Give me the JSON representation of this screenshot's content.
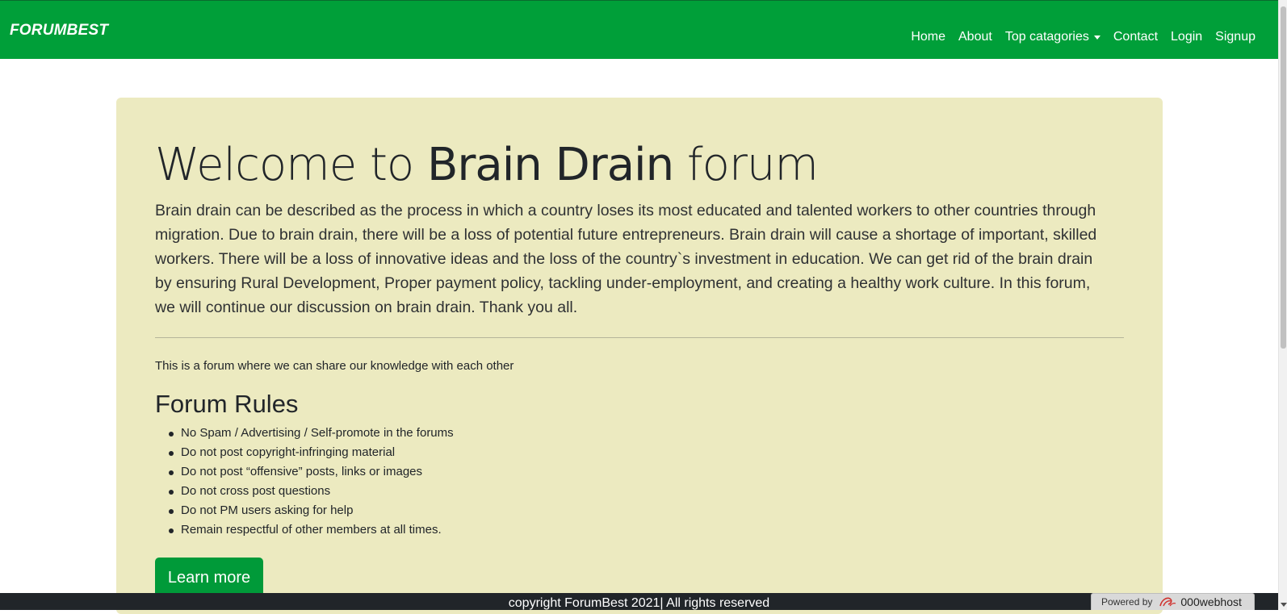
{
  "navbar": {
    "brand": "FORUMBEST",
    "links": [
      {
        "label": "Home"
      },
      {
        "label": "About"
      },
      {
        "label": "Top catagories"
      },
      {
        "label": "Contact"
      },
      {
        "label": "Login"
      },
      {
        "label": "Signup"
      }
    ]
  },
  "jumbotron": {
    "title_prefix": "Welcome to ",
    "title_bold": "Brain Drain",
    "title_suffix": " forum",
    "lead": "Brain drain can be described as the process in which a country loses its most educated and talented workers to other countries through migration. Due to brain drain, there will be a loss of potential future entrepreneurs. Brain drain will cause a shortage of important, skilled workers. There will be a loss of innovative ideas and the loss of the country`s investment in education. We can get rid of the brain drain by ensuring Rural Development, Proper payment policy, tackling under-employment, and creating a healthy work culture. In this forum, we will continue our discussion on brain drain. Thank you all.",
    "intro": "This is a forum where we can share our knowledge with each other",
    "rules_title": "Forum Rules",
    "rules": [
      "No Spam / Advertising / Self-promote in the forums",
      "Do not post copyright-infringing material",
      "Do not post “offensive” posts, links or images",
      "Do not cross post questions",
      "Do not PM users asking for help",
      "Remain respectful of other members at all times."
    ],
    "button_label": "Learn more"
  },
  "footer": {
    "text": "copyright ForumBest 2021| All rights reserved"
  },
  "powered_badge": {
    "label": "Powered by",
    "brand": "000webhost"
  },
  "colors": {
    "navbar_bg": "#009f39",
    "jumbotron_bg": "#eceac0",
    "button_bg": "#009a39",
    "footer_bg": "#212529"
  }
}
